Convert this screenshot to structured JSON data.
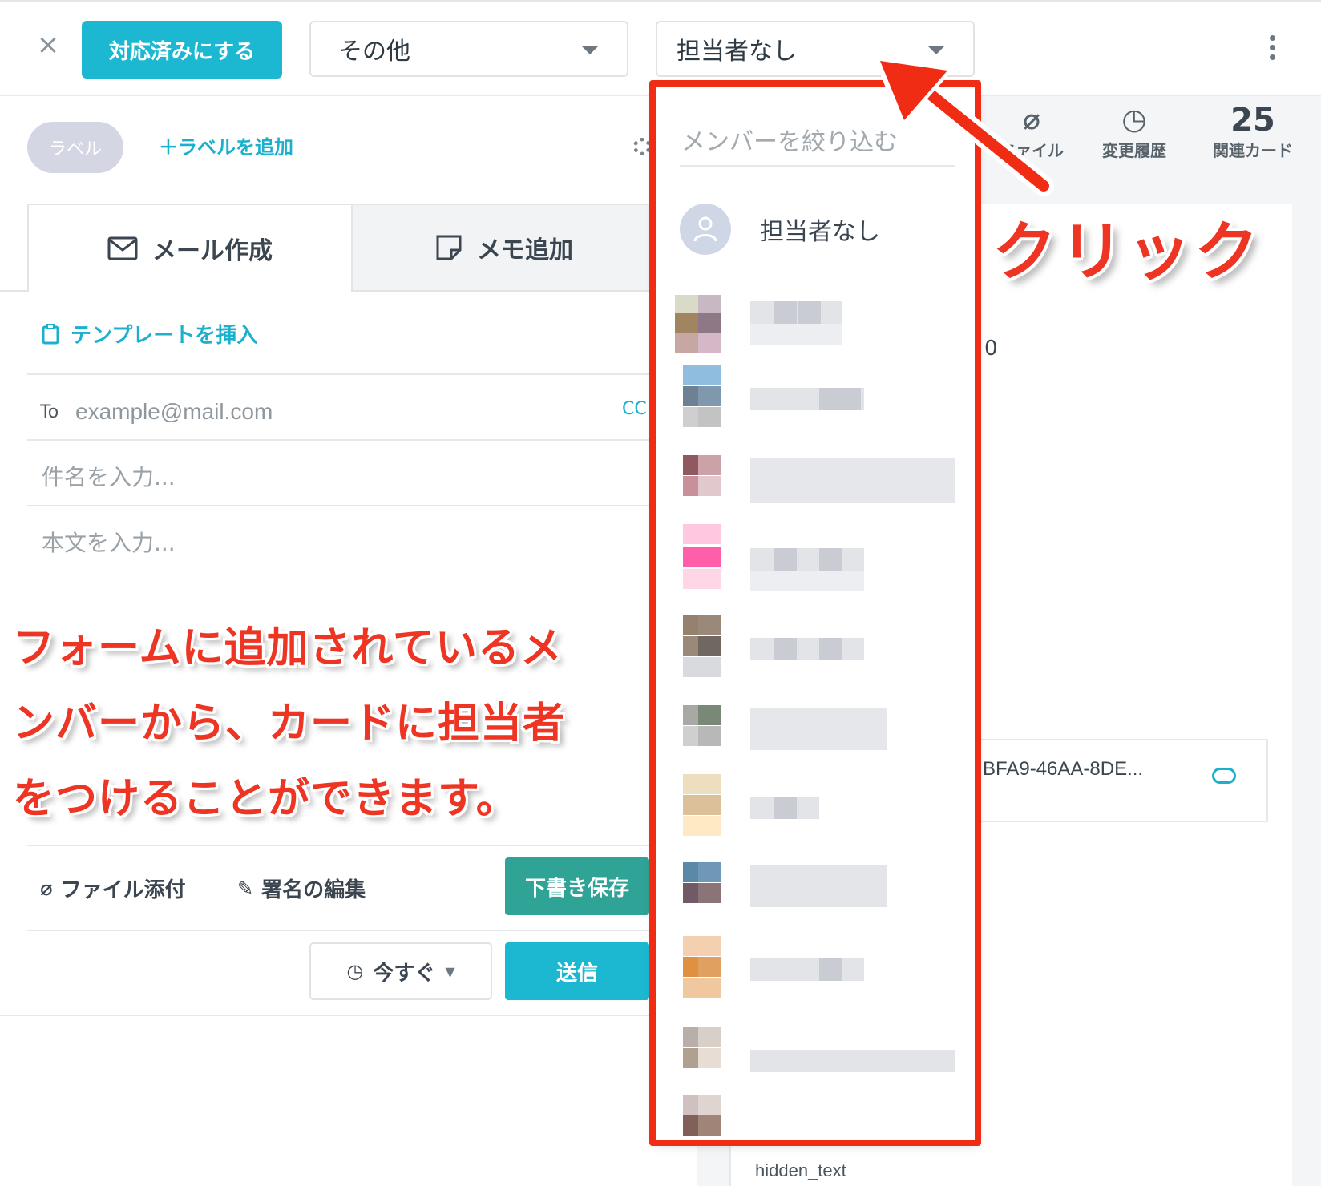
{
  "header": {
    "done_button": "対応済みにする",
    "status_select": "その他",
    "assignee_select": "担当者なし"
  },
  "labels": {
    "label_pill": "ラベル",
    "add_label": "＋ラベルを追加"
  },
  "compose": {
    "tabs": [
      {
        "label": "メール作成"
      },
      {
        "label": "メモ追加"
      }
    ],
    "template_link": "テンプレートを挿入",
    "to_label": "To",
    "to_placeholder": "example@mail.com",
    "cc_label": "CC",
    "subject_placeholder": "件名を入力...",
    "body_placeholder": "本文を入力...",
    "attach_label": "ファイル添付",
    "signature_label": "署名の編集",
    "draft_button": "下書き保存",
    "schedule_select": "今すぐ",
    "send_button": "送信"
  },
  "side_panel": {
    "tabs": [
      {
        "label": "ファイル",
        "icon": "paperclip-icon"
      },
      {
        "label": "変更履歴",
        "icon": "clock-icon"
      },
      {
        "label": "関連カード",
        "count": "25"
      }
    ],
    "partial_value": "0",
    "file_name": "BFA9-46AA-8DE...",
    "hidden_text": "hidden_text"
  },
  "dropdown": {
    "filter_placeholder": "メンバーを絞り込む",
    "none_option": "担当者なし",
    "members_blurred": 10
  },
  "annotations": {
    "click": "クリック",
    "lines": [
      "フォームに追加されているメ",
      "ンバーから、カードに担当者",
      "をつけることができます。"
    ]
  },
  "colors": {
    "accent": "#1cb8d2",
    "draft": "#2ea396",
    "annotation_red": "#ee3422"
  }
}
